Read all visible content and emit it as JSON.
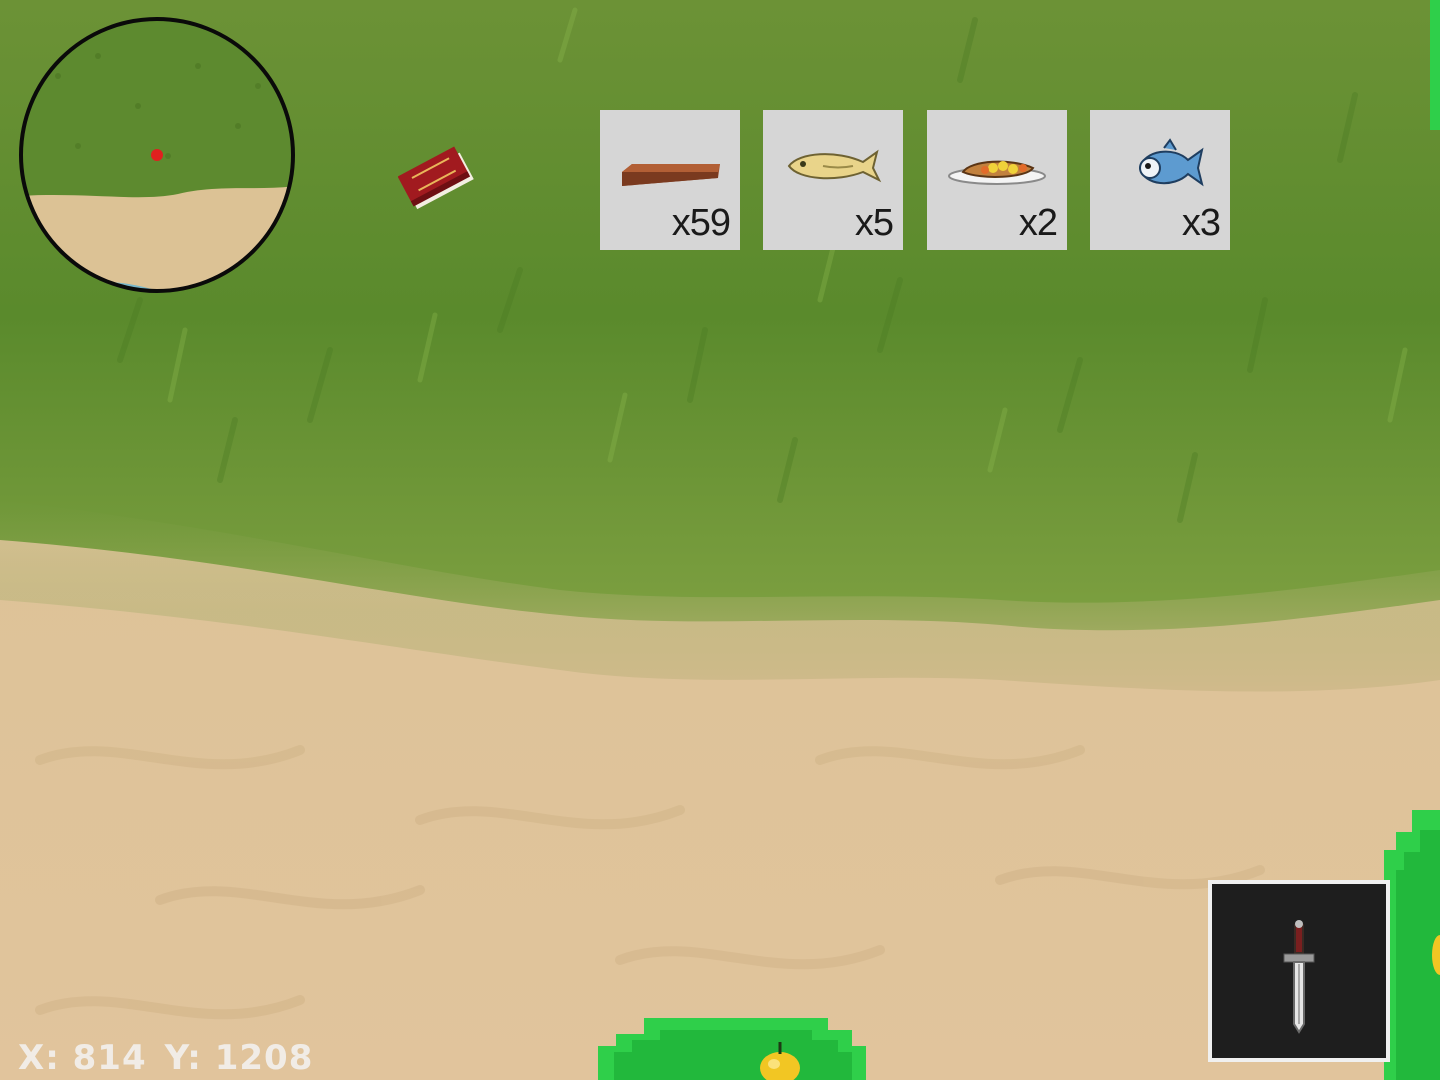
{
  "coordinates": {
    "x_text": "X: 814",
    "y_text": "Y: 1208"
  },
  "inventory": {
    "slots": [
      {
        "icon": "wood-plank-icon",
        "quantity": "x59"
      },
      {
        "icon": "raw-fish-icon",
        "quantity": "x5"
      },
      {
        "icon": "cooked-fish-plate-icon",
        "quantity": "x2"
      },
      {
        "icon": "blue-fish-icon",
        "quantity": "x3"
      }
    ]
  },
  "equipped": {
    "icon": "dagger-icon"
  },
  "world_items": [
    {
      "icon": "red-book-icon"
    }
  ],
  "colors": {
    "grass": "#5f8a2e",
    "sand": "#dcbf95",
    "slot_bg": "#d6d6d6",
    "equipped_bg": "#1e1e1e",
    "bush": "#2fcf4a",
    "player_marker": "#e0201f"
  }
}
